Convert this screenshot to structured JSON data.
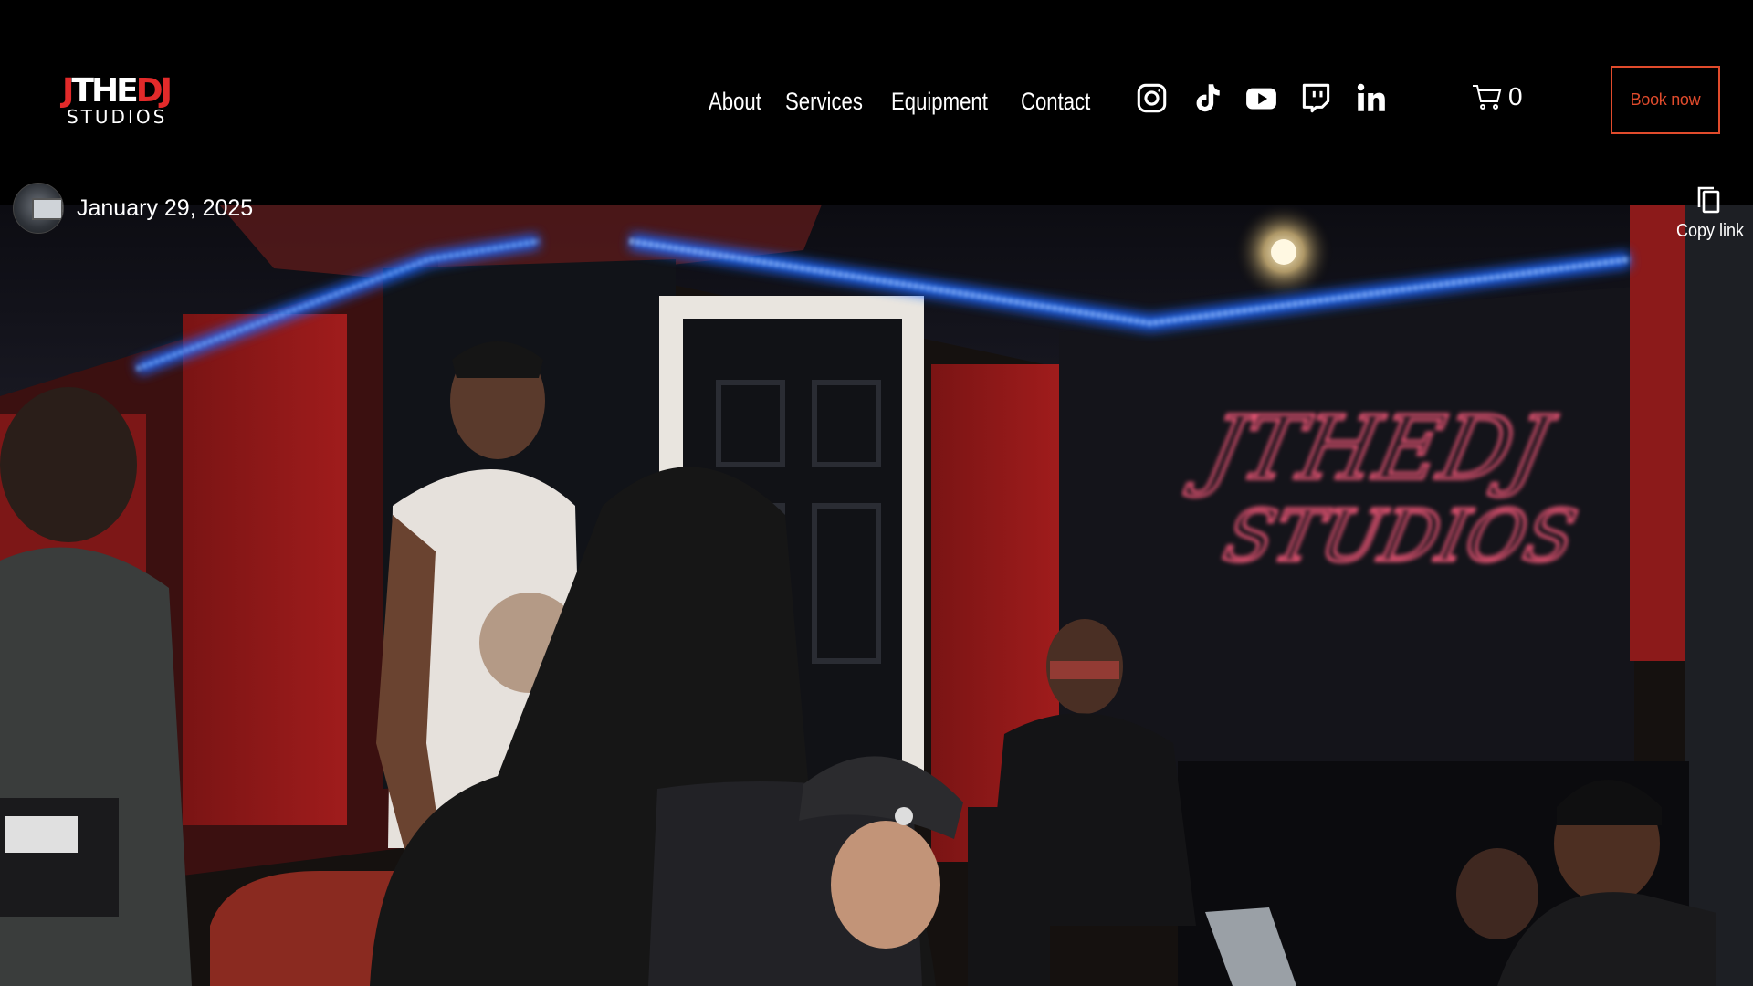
{
  "logo": {
    "line1_left": "J",
    "line1_mid": "THE",
    "line1_right": "DJ",
    "line2": "STUDIOS"
  },
  "nav": {
    "items": [
      "About",
      "Services",
      "Equipment",
      "Contact"
    ]
  },
  "social": {
    "icons": [
      "instagram-icon",
      "tiktok-icon",
      "youtube-icon",
      "twitch-icon",
      "linkedin-icon"
    ]
  },
  "cart": {
    "count": "0"
  },
  "book_button": {
    "label": "Book now",
    "color": "#e14b2c"
  },
  "post": {
    "date": "January 29, 2025",
    "copy_link_label": "Copy link"
  },
  "neon_sign": {
    "line1": "JTHEDJ",
    "line2": "STUDIOS"
  },
  "colors": {
    "background": "#000000",
    "accent": "#e14b2c",
    "logo_red": "#e22a2a",
    "neon_blue": "#2f7dff",
    "neon_pink": "#ff6b8a"
  }
}
